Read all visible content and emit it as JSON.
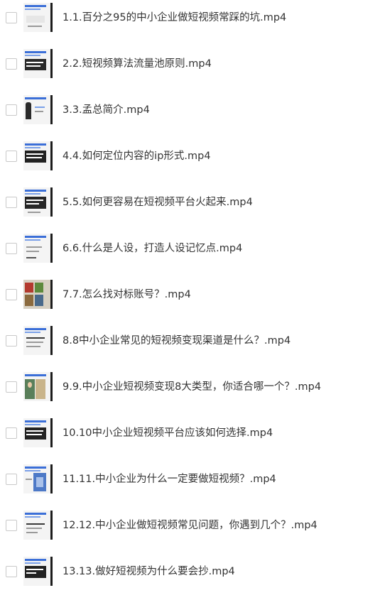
{
  "files": [
    {
      "name": "1.1.百分之95的中小企业做短视频常踩的坑.mp4",
      "thumb": "slide-light"
    },
    {
      "name": "2.2.短视频算法流量池原则.mp4",
      "thumb": "slide-dark-text"
    },
    {
      "name": "3.3.孟总简介.mp4",
      "thumb": "slide-person"
    },
    {
      "name": "4.4.如何定位内容的ip形式.mp4",
      "thumb": "slide-dark-text"
    },
    {
      "name": "5.5.如何更容易在短视频平台火起来.mp4",
      "thumb": "slide-dark-text"
    },
    {
      "name": "6.6.什么是人设，打造人设记忆点.mp4",
      "thumb": "slide-light"
    },
    {
      "name": "7.7.怎么找对标账号？.mp4",
      "thumb": "slide-photos"
    },
    {
      "name": "8.8中小企业常见的短视频变现渠道是什么？.mp4",
      "thumb": "slide-light-text"
    },
    {
      "name": "9.9.中小企业短视频变现8大类型，你适合哪一个？.mp4",
      "thumb": "slide-photos"
    },
    {
      "name": "10.10中小企业短视频平台应该如何选择.mp4",
      "thumb": "slide-dark-text"
    },
    {
      "name": "11.11.中小企业为什么一定要做短视频？.mp4",
      "thumb": "slide-blue"
    },
    {
      "name": "12.12.中小企业做短视频常见问题，你遇到几个？.mp4",
      "thumb": "slide-light-text"
    },
    {
      "name": "13.13.做好短视频为什么要会抄.mp4",
      "thumb": "slide-dark-text"
    }
  ],
  "colors": {
    "text": "#333333",
    "checkbox_border": "#c9c9c9",
    "accent": "#3b6fd8"
  }
}
